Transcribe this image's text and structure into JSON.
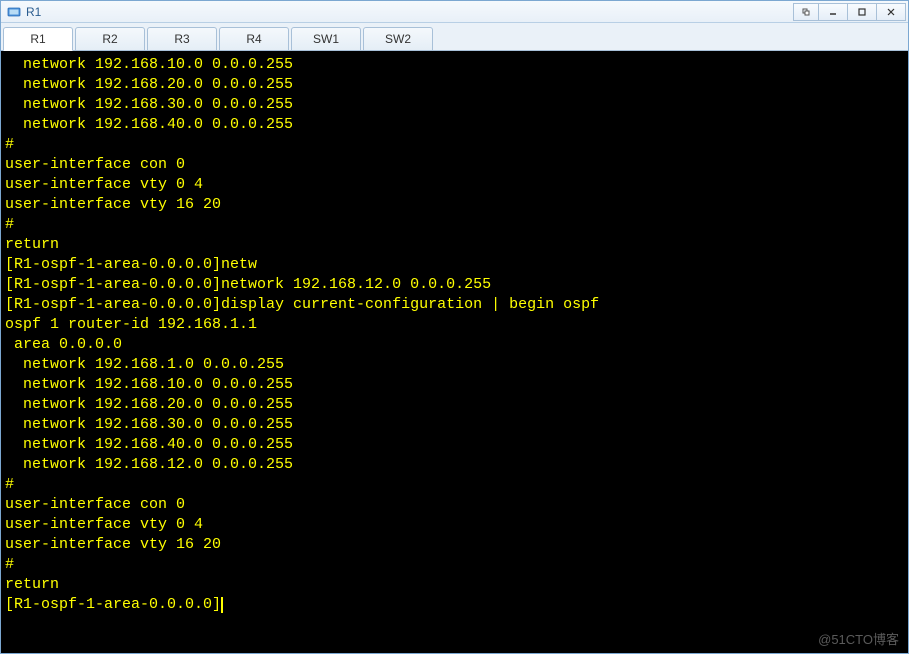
{
  "window": {
    "title": "R1"
  },
  "tabs": [
    {
      "label": "R1",
      "active": true
    },
    {
      "label": "R2",
      "active": false
    },
    {
      "label": "R3",
      "active": false
    },
    {
      "label": "R4",
      "active": false
    },
    {
      "label": "SW1",
      "active": false
    },
    {
      "label": "SW2",
      "active": false
    }
  ],
  "terminal_lines": [
    "  network 192.168.10.0 0.0.0.255",
    "  network 192.168.20.0 0.0.0.255",
    "  network 192.168.30.0 0.0.0.255",
    "  network 192.168.40.0 0.0.0.255",
    "#",
    "user-interface con 0",
    "user-interface vty 0 4",
    "user-interface vty 16 20",
    "#",
    "return",
    "[R1-ospf-1-area-0.0.0.0]netw",
    "[R1-ospf-1-area-0.0.0.0]network 192.168.12.0 0.0.0.255",
    "[R1-ospf-1-area-0.0.0.0]display current-configuration | begin ospf",
    "ospf 1 router-id 192.168.1.1",
    " area 0.0.0.0",
    "  network 192.168.1.0 0.0.0.255",
    "  network 192.168.10.0 0.0.0.255",
    "  network 192.168.20.0 0.0.0.255",
    "  network 192.168.30.0 0.0.0.255",
    "  network 192.168.40.0 0.0.0.255",
    "  network 192.168.12.0 0.0.0.255",
    "#",
    "user-interface con 0",
    "user-interface vty 0 4",
    "user-interface vty 16 20",
    "#",
    "return"
  ],
  "prompt": "[R1-ospf-1-area-0.0.0.0]",
  "watermark": "@51CTO博客"
}
